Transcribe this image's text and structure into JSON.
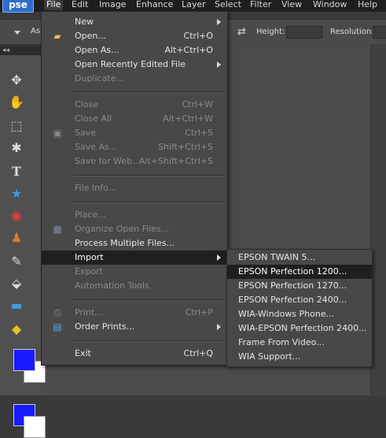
{
  "app": {
    "logo_text": "pse"
  },
  "menubar": {
    "items": [
      "File",
      "Edit",
      "Image",
      "Enhance",
      "Layer",
      "Select",
      "Filter",
      "View",
      "Window",
      "Help"
    ]
  },
  "options_bar": {
    "aspect_label": "Asp",
    "height_label": "Height:",
    "resolution_label": "Resolution:"
  },
  "toolbox": {
    "header": "◂◂"
  },
  "file_menu": {
    "items": [
      {
        "label": "New",
        "shortcut": "",
        "enabled": true,
        "submenu": true,
        "icon": ""
      },
      {
        "label": "Open...",
        "shortcut": "Ctrl+O",
        "enabled": true,
        "submenu": false,
        "icon": "folder-icon"
      },
      {
        "label": "Open As...",
        "shortcut": "Alt+Ctrl+O",
        "enabled": true,
        "submenu": false,
        "icon": ""
      },
      {
        "label": "Open Recently Edited File",
        "shortcut": "",
        "enabled": true,
        "submenu": true,
        "icon": ""
      },
      {
        "label": "Duplicate...",
        "shortcut": "",
        "enabled": false,
        "submenu": false,
        "icon": ""
      },
      {
        "label": "Close",
        "shortcut": "Ctrl+W",
        "enabled": false,
        "submenu": false,
        "icon": ""
      },
      {
        "label": "Close All",
        "shortcut": "Alt+Ctrl+W",
        "enabled": false,
        "submenu": false,
        "icon": ""
      },
      {
        "label": "Save",
        "shortcut": "Ctrl+S",
        "enabled": false,
        "submenu": false,
        "icon": "save-icon"
      },
      {
        "label": "Save As...",
        "shortcut": "Shift+Ctrl+S",
        "enabled": false,
        "submenu": false,
        "icon": ""
      },
      {
        "label": "Save for Web...",
        "shortcut": "Alt+Shift+Ctrl+S",
        "enabled": false,
        "submenu": false,
        "icon": ""
      },
      {
        "label": "File Info...",
        "shortcut": "",
        "enabled": false,
        "submenu": false,
        "icon": ""
      },
      {
        "label": "Place...",
        "shortcut": "",
        "enabled": false,
        "submenu": false,
        "icon": ""
      },
      {
        "label": "Organize Open Files...",
        "shortcut": "",
        "enabled": false,
        "submenu": false,
        "icon": "organize-icon"
      },
      {
        "label": "Process Multiple Files...",
        "shortcut": "",
        "enabled": true,
        "submenu": false,
        "icon": ""
      },
      {
        "label": "Import",
        "shortcut": "",
        "enabled": true,
        "submenu": true,
        "icon": ""
      },
      {
        "label": "Export",
        "shortcut": "",
        "enabled": false,
        "submenu": false,
        "icon": ""
      },
      {
        "label": "Automation Tools",
        "shortcut": "",
        "enabled": false,
        "submenu": false,
        "icon": ""
      },
      {
        "label": "Print...",
        "shortcut": "Ctrl+P",
        "enabled": false,
        "submenu": false,
        "icon": "print-icon"
      },
      {
        "label": "Order Prints...",
        "shortcut": "",
        "enabled": true,
        "submenu": true,
        "icon": "order-prints-icon"
      },
      {
        "label": "Exit",
        "shortcut": "Ctrl+Q",
        "enabled": true,
        "submenu": false,
        "icon": ""
      }
    ],
    "highlighted": "Import"
  },
  "import_submenu": {
    "items": [
      "EPSON TWAIN 5...",
      "EPSON Perfection 1200...",
      "EPSON Perfection 1270...",
      "EPSON Perfection 2400...",
      "WIA-Windows Phone...",
      "WIA-EPSON Perfection 2400...",
      "Frame From Video...",
      "WIA Support..."
    ],
    "highlighted": "EPSON Perfection 1200..."
  },
  "colors": {
    "foreground": "#1a1aff",
    "background": "#ffffff",
    "menu_bg": "#484848",
    "highlight_bg": "#1f1f1f"
  }
}
